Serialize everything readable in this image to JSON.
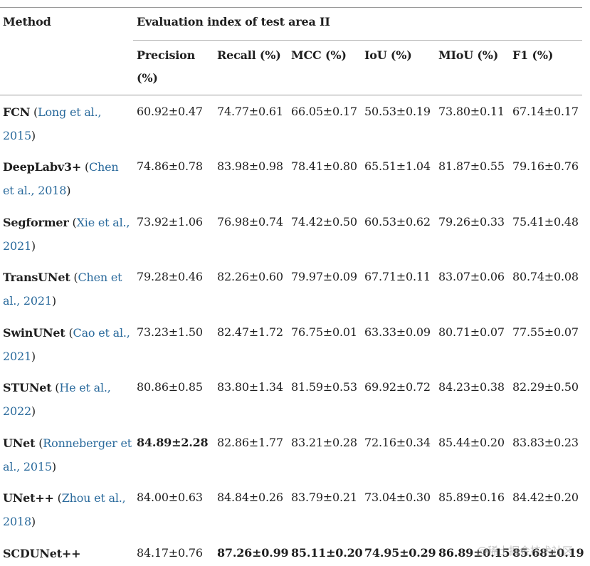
{
  "header": {
    "method": "Method",
    "group": "Evaluation index of test area II",
    "columns": [
      "Precision (%)",
      "Recall (%)",
      "MCC (%)",
      "IoU (%)",
      "MIoU (%)",
      "F1 (%)"
    ]
  },
  "rows": [
    {
      "name": "FCN",
      "cite": "Long et al., 2015",
      "values": [
        "60.92±0.47",
        "74.77±0.61",
        "66.05±0.17",
        "50.53±0.19",
        "73.80±0.11",
        "67.14±0.17"
      ],
      "bold": []
    },
    {
      "name": "DeepLabv3+",
      "cite": "Chen et al., 2018",
      "values": [
        "74.86±0.78",
        "83.98±0.98",
        "78.41±0.80",
        "65.51±1.04",
        "81.87±0.55",
        "79.16±0.76"
      ],
      "bold": []
    },
    {
      "name": "Segformer",
      "cite": "Xie et al., 2021",
      "values": [
        "73.92±1.06",
        "76.98±0.74",
        "74.42±0.50",
        "60.53±0.62",
        "79.26±0.33",
        "75.41±0.48"
      ],
      "bold": []
    },
    {
      "name": "TransUNet",
      "cite": "Chen et al., 2021",
      "values": [
        "79.28±0.46",
        "82.26±0.60",
        "79.97±0.09",
        "67.71±0.11",
        "83.07±0.06",
        "80.74±0.08"
      ],
      "bold": []
    },
    {
      "name": "SwinUNet",
      "cite": "Cao et al., 2021",
      "values": [
        "73.23±1.50",
        "82.47±1.72",
        "76.75±0.01",
        "63.33±0.09",
        "80.71±0.07",
        "77.55±0.07"
      ],
      "bold": []
    },
    {
      "name": "STUNet",
      "cite": "He et al., 2022",
      "values": [
        "80.86±0.85",
        "83.80±1.34",
        "81.59±0.53",
        "69.92±0.72",
        "84.23±0.38",
        "82.29±0.50"
      ],
      "bold": []
    },
    {
      "name": "UNet",
      "cite": "Ronneberger et al., 2015",
      "values": [
        "84.89±2.28",
        "82.86±1.77",
        "83.21±0.28",
        "72.16±0.34",
        "85.44±0.20",
        "83.83±0.23"
      ],
      "bold": [
        0
      ]
    },
    {
      "name": "UNet++",
      "cite": "Zhou et al., 2018",
      "values": [
        "84.00±0.63",
        "84.84±0.26",
        "83.79±0.21",
        "73.04±0.30",
        "85.89±0.16",
        "84.42±0.20"
      ],
      "bold": []
    },
    {
      "name": "SCDUNet++",
      "cite": "",
      "values": [
        "84.17±0.76",
        "87.26±0.99",
        "85.11±0.20",
        "74.95±0.29",
        "86.89±0.15",
        "85.68±0.19"
      ],
      "bold": [
        1,
        2,
        3,
        4,
        5
      ]
    }
  ],
  "watermark": "@稀土掘金技术社区"
}
